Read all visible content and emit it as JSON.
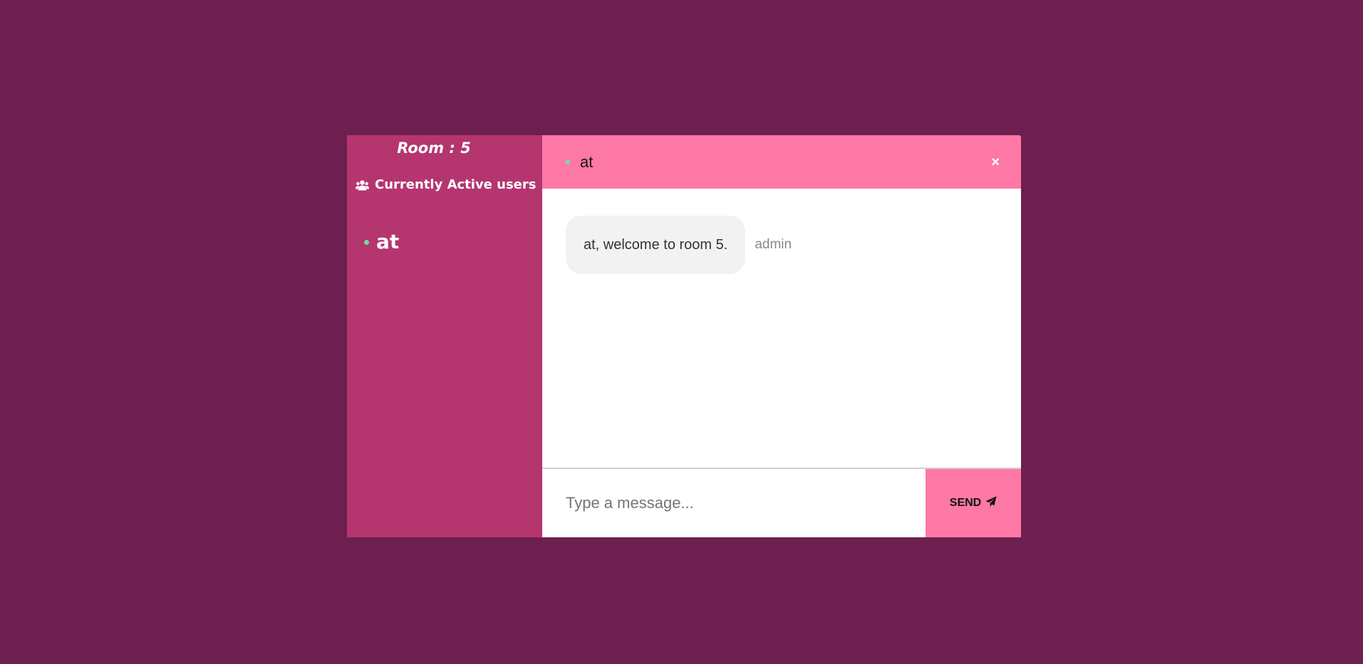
{
  "sidebar": {
    "room_title": "Room : 5",
    "users_heading": "Currently Active users",
    "users": [
      {
        "name": "at",
        "status_color": "#7fd6a2"
      }
    ]
  },
  "chat": {
    "header": {
      "name": "at",
      "status_color": "#7fd6a2",
      "close_label": "×"
    },
    "messages": [
      {
        "text": "at, welcome to room 5.",
        "sender": "admin"
      }
    ],
    "input": {
      "value": "",
      "placeholder": "Type a message..."
    },
    "send_label": "SEND"
  },
  "colors": {
    "page_background": "#6d204f",
    "sidebar_background": "#b5356f",
    "accent": "#fe78a6",
    "bubble": "#f2f2f2"
  },
  "icons": {
    "users_heading": "users-icon",
    "send": "paper-plane-icon"
  }
}
